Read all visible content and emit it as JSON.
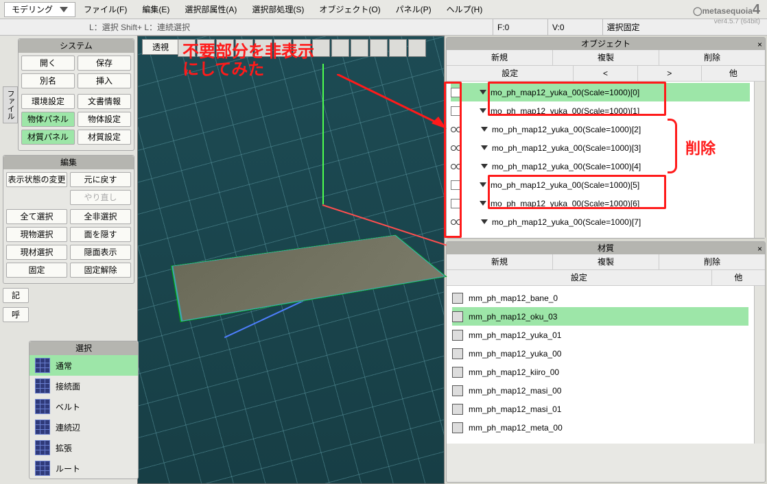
{
  "mode": "モデリング",
  "menu": {
    "file": "ファイル(F)",
    "edit": "編集(E)",
    "selattr": "選択部属性(A)",
    "selproc": "選択部処理(S)",
    "object": "オブジェクト(O)",
    "panel": "パネル(P)",
    "help": "ヘルプ(H)"
  },
  "brand": {
    "name": "metasequoia",
    "suffix": "4",
    "ver": "ver4.5.7 (64bit)"
  },
  "hint": "L：選択 Shift+ L：連続選択",
  "info": {
    "f": "F:0",
    "v": "V:0",
    "selfix": "選択固定"
  },
  "viewport_tab": "透視",
  "annotation_main": "不要部分を非表示\nにしてみた",
  "annotation_delete": "削除",
  "sys": {
    "title": "システム",
    "file_side": "ファイル",
    "open": "開く",
    "save": "保存",
    "alias": "別名",
    "insert": "挿入",
    "env": "環境設定",
    "docinfo": "文書情報",
    "objpanel": "物体パネル",
    "objset": "物体設定",
    "matpanel": "材質パネル",
    "matset": "材質設定"
  },
  "edit": {
    "title": "編集",
    "viewchg": "表示状態の変更",
    "undo": "元に戻す",
    "redo": "やり直し",
    "selall": "全て選択",
    "deselall": "全非選択",
    "selreal": "現物選択",
    "hideface": "面を隠す",
    "selmat": "現材選択",
    "hideback": "隠面表示",
    "fix": "固定",
    "unfix": "固定解除"
  },
  "left_extra": {
    "a": "記",
    "b": "呼"
  },
  "sel": {
    "title": "選択",
    "normal": "通常",
    "adj": "接続面",
    "belt": "ベルト",
    "loop": "連続辺",
    "expand": "拡張",
    "route": "ルート"
  },
  "obj": {
    "title": "オブジェクト",
    "new": "新規",
    "dup": "複製",
    "del": "削除",
    "set": "設定",
    "lt": "<",
    "gt": ">",
    "other": "他",
    "items": [
      "mo_ph_map12_yuka_00(Scale=1000)[0]",
      "mo_ph_map12_yuka_00(Scale=1000)[1]",
      "mo_ph_map12_yuka_00(Scale=1000)[2]",
      "mo_ph_map12_yuka_00(Scale=1000)[3]",
      "mo_ph_map12_yuka_00(Scale=1000)[4]",
      "mo_ph_map12_yuka_00(Scale=1000)[5]",
      "mo_ph_map12_yuka_00(Scale=1000)[6]",
      "mo_ph_map12_yuka_00(Scale=1000)[7]"
    ]
  },
  "mat": {
    "title": "材質",
    "new": "新規",
    "dup": "複製",
    "del": "削除",
    "set": "設定",
    "other": "他",
    "items": [
      "mm_ph_map12_bane_0",
      "mm_ph_map12_oku_03",
      "mm_ph_map12_yuka_01",
      "mm_ph_map12_yuka_00",
      "mm_ph_map12_kiiro_00",
      "mm_ph_map12_masi_00",
      "mm_ph_map12_masi_01",
      "mm_ph_map12_meta_00"
    ]
  }
}
